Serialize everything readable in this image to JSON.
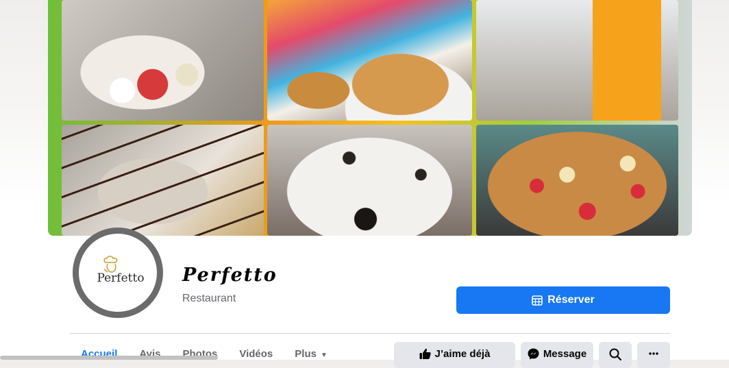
{
  "page": {
    "name": "Perfetto",
    "category": "Restaurant",
    "logo_text": "Perfetto"
  },
  "cta": {
    "reserve_label": "Réserver",
    "icon": "calendar-icon"
  },
  "tabs": [
    {
      "label": "Accueil",
      "active": true
    },
    {
      "label": "Avis"
    },
    {
      "label": "Photos"
    },
    {
      "label": "Vidéos"
    },
    {
      "label": "Plus",
      "icon": "caret-down-icon"
    }
  ],
  "actions": {
    "like_label": "J’aime déjà",
    "message_label": "Message",
    "search_icon": "search-icon",
    "more_icon": "more-icon"
  },
  "colors": {
    "accent": "#1877f2",
    "button_bg": "#e4e6eb",
    "avatar_ring": "#6b6b6b"
  }
}
